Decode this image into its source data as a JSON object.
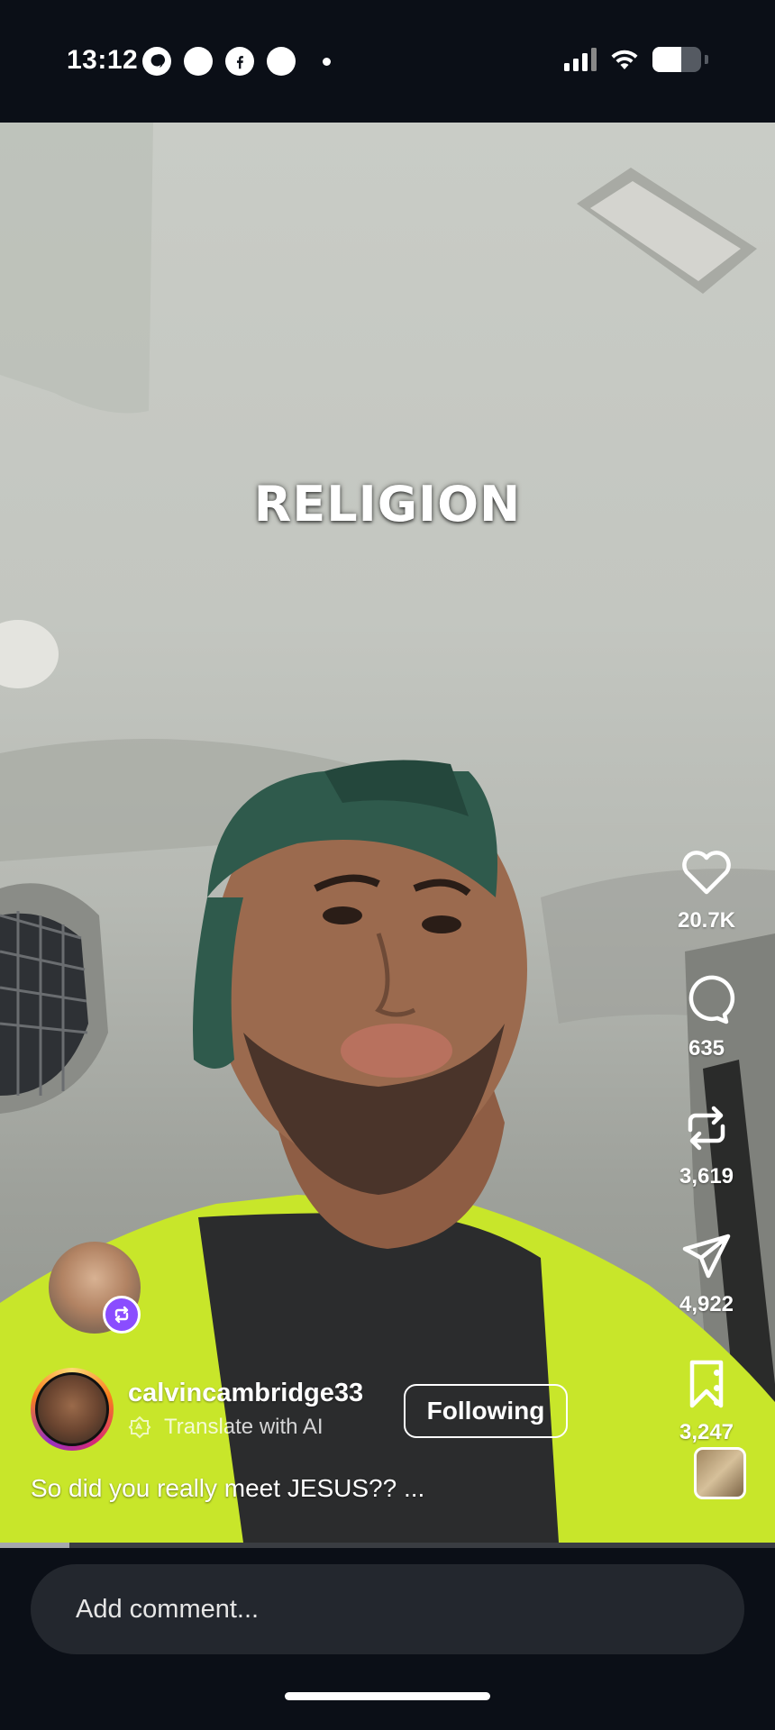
{
  "status_bar": {
    "time": "13:12",
    "left_icons": [
      "threads-icon",
      "messenger-icon",
      "facebook-icon",
      "messenger-icon"
    ],
    "battery_level": 0.6
  },
  "video": {
    "overlay_text": "RELIGION",
    "progress": 0.09
  },
  "actions": {
    "likes": "20.7K",
    "comments": "635",
    "reposts": "3,619",
    "shares": "4,922",
    "saves": "3,247"
  },
  "author": {
    "username": "calvincambridge33",
    "translate_label": "Translate with AI",
    "follow_label": "Following"
  },
  "caption": "So did you really meet JESUS?? ...",
  "comment": {
    "placeholder": "Add comment..."
  }
}
